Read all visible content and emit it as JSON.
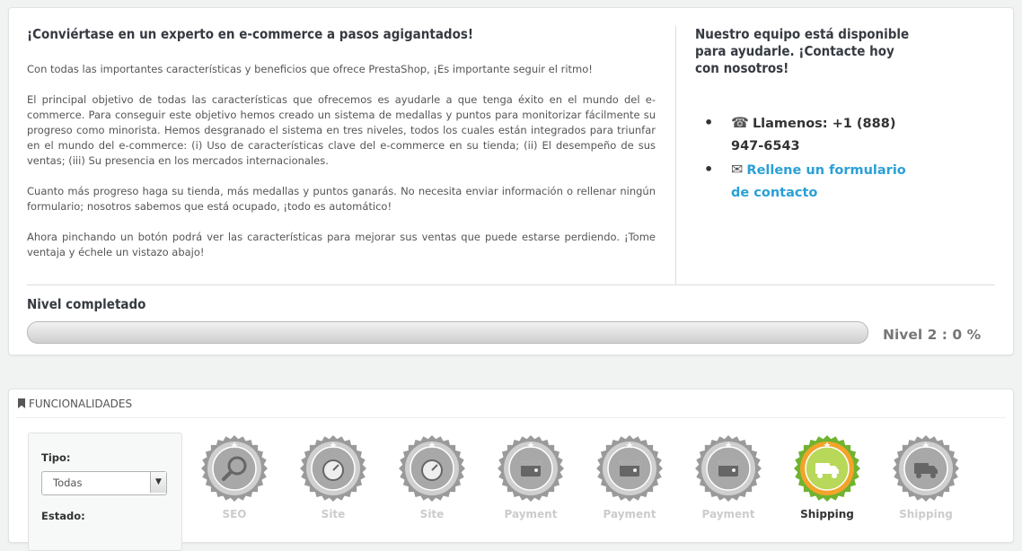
{
  "intro": {
    "title": "¡Conviértase en un experto en e-commerce a pasos agigantados!",
    "paragraphs": [
      "Con todas las importantes características y beneficios que ofrece PrestaShop, ¡Es importante seguir el ritmo!",
      "El principal objetivo de todas las características que ofrecemos es ayudarle a que tenga éxito en el mundo del e-commerce. Para conseguir este objetivo hemos creado un sistema de medallas y puntos para monitorizar fácilmente su progreso como minorista. Hemos desgranado el sistema en tres niveles, todos los cuales están integrados para triunfar en el mundo del e-commerce: (i) Uso de características clave del e-commerce en su tienda; (ii) El desempeño de sus ventas; (iii) Su presencia en los mercados internacionales.",
      "Cuanto más progreso haga su tienda, más medallas y puntos ganarás. No necesita enviar información o rellenar ningún formulario; nosotros sabemos que está ocupado, ¡todo es automático!",
      "Ahora pinchando un botón podrá ver las características para mejorar sus ventas que puede estarse perdiendo. ¡Tome ventaja y échele un vistazo abajo!"
    ]
  },
  "contact": {
    "title": "Nuestro equipo está disponible para ayudarle. ¡Contacte hoy con nosotros!",
    "phone": "Llamenos: +1 (888) 947-6543",
    "link": "Rellene un formulario de contacto",
    "phone_icon": "☎",
    "mail_icon": "✉"
  },
  "level": {
    "title": "Nivel completado",
    "progress": 0,
    "value_text": "Nivel 2 : 0 %"
  },
  "features": {
    "heading": "FUNCIONALIDADES",
    "filter": {
      "type_label": "Tipo:",
      "type_value": "Todas",
      "state_label": "Estado:"
    },
    "badges": [
      {
        "label": "SEO",
        "icon": "magnifier",
        "active": false
      },
      {
        "label": "Site",
        "icon": "gauge",
        "active": false
      },
      {
        "label": "Site",
        "icon": "gauge",
        "active": false
      },
      {
        "label": "Payment",
        "icon": "wallet",
        "active": false
      },
      {
        "label": "Payment",
        "icon": "wallet",
        "active": false
      },
      {
        "label": "Payment",
        "icon": "wallet",
        "active": false
      },
      {
        "label": "Shipping",
        "icon": "truck",
        "active": true
      },
      {
        "label": "Shipping",
        "icon": "truck",
        "active": false
      }
    ]
  },
  "colors": {
    "accent": "#2aa0d6",
    "medal_grey": "#9a9a9a",
    "medal_green": "#6fb32f",
    "medal_orange": "#f2a42a"
  }
}
